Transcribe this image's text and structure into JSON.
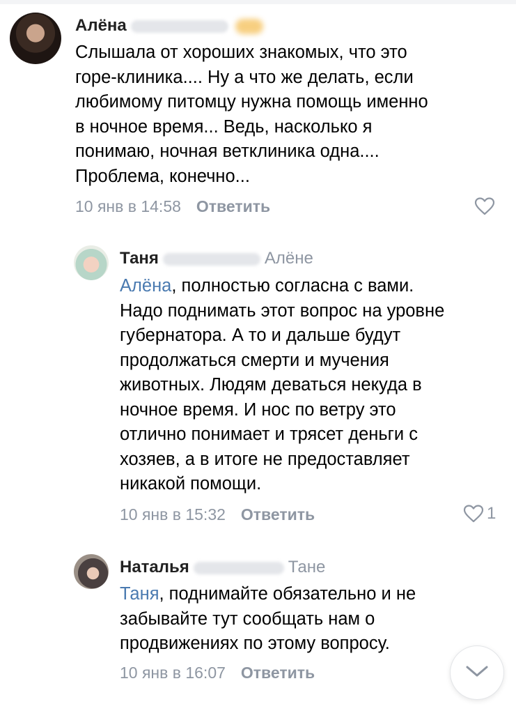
{
  "comments": [
    {
      "author": "Алёна",
      "reply_to": "",
      "text": "Слышала от хороших знакомых, что это\nгоре-клиника.... Ну а что же делать, если\nлюбимому питомцу нужна помощь именно\nв ночное время... Ведь, насколько я\nпонимаю, ночная ветклиника одна....\nПроблема, конечно...",
      "date": "10 янв в 14:58",
      "reply_label": "Ответить",
      "likes": ""
    },
    {
      "author": "Таня",
      "reply_to": "Алёне",
      "mention": "Алёна",
      "text": ", полностью согласна с вами.\nНадо поднимать этот вопрос на уровне\nгубернатора. А то и дальше будут\nпродолжаться смерти и мучения\nживотных. Людям деваться некуда в\nночное время. И нос по ветру это\nотлично понимает и трясет деньги с\nхозяев, а в итоге не предоставляет\nникакой помощи.",
      "date": "10 янв в 15:32",
      "reply_label": "Ответить",
      "likes": "1"
    },
    {
      "author": "Наталья",
      "reply_to": "Тане",
      "mention": "Таня",
      "text": ", поднимайте обязательно и не\nзабывайте тут сообщать нам о\nпродвижениях по этому вопросу.",
      "date": "10 янв в 16:07",
      "reply_label": "Ответить",
      "likes": ""
    }
  ],
  "icons": {
    "like": "heart-outline-icon",
    "scroll": "chevron-down-icon"
  },
  "colors": {
    "mention": "#4a7ab0",
    "muted": "#8e96a2",
    "text": "#000000"
  }
}
